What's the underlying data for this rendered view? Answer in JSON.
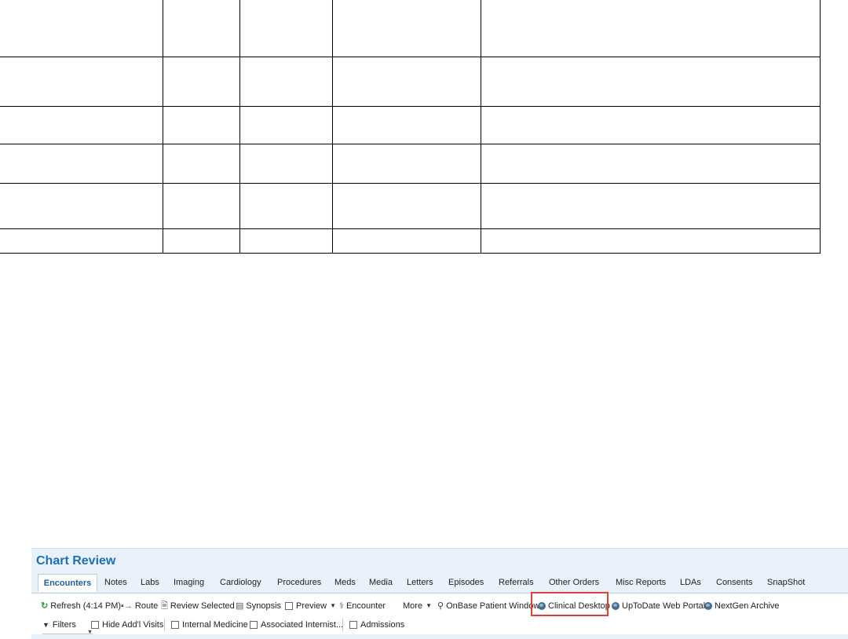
{
  "chart_review": {
    "title": "Chart Review",
    "tabs": [
      {
        "label": "Encounters",
        "active": true
      },
      {
        "label": "Notes"
      },
      {
        "label": "Labs"
      },
      {
        "label": "Imaging"
      },
      {
        "label": "Cardiology"
      },
      {
        "label": "Procedures"
      },
      {
        "label": "Meds"
      },
      {
        "label": "Media"
      },
      {
        "label": "Letters"
      },
      {
        "label": "Episodes"
      },
      {
        "label": "Referrals"
      },
      {
        "label": "Other Orders"
      },
      {
        "label": "Misc Reports"
      },
      {
        "label": "LDAs"
      },
      {
        "label": "Consents"
      },
      {
        "label": "SnapShot"
      }
    ],
    "toolbar": {
      "refresh": "Refresh (4:14 PM)",
      "route": "Route",
      "review_selected": "Review Selected",
      "synopsis": "Synopsis",
      "preview": "Preview",
      "encounter": "Encounter",
      "more": "More",
      "onbase": "OnBase Patient Window",
      "clinical_desktop": "Clinical Desktop",
      "uptodate": "UpToDate Web Portal",
      "nextgen": "NextGen Archive"
    },
    "filters": {
      "filters": "Filters",
      "hide_addl": "Hide Add'l Visits",
      "internal_medicine": "Internal Medicine",
      "associated_internist": "Associated Internist...",
      "admissions": "Admissions"
    },
    "colors": {
      "title": "#1f6fb5",
      "panel_bg": "#e9f2fa",
      "highlight": "#d9433b"
    },
    "icons": [
      "refresh-icon",
      "route-icon",
      "document-icon",
      "synopsis-icon",
      "stethoscope-icon",
      "search-icon",
      "globe-icon",
      "filter-icon"
    ]
  }
}
